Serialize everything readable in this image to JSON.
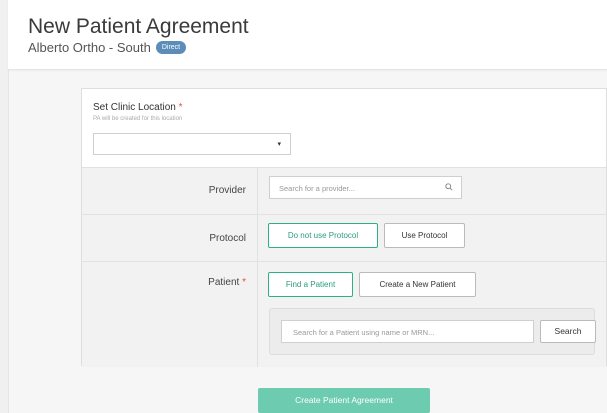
{
  "header": {
    "title": "New Patient Agreement",
    "subtitle": "Alberto Ortho - South",
    "badge": "Direct"
  },
  "location": {
    "label": "Set Clinic Location",
    "required_mark": "*",
    "help_text": "PA will be created for this location",
    "selected_value": "",
    "caret": "▾"
  },
  "provider": {
    "label": "Provider",
    "placeholder": "Search for a provider...",
    "search_icon": "search-icon"
  },
  "protocol": {
    "label": "Protocol",
    "options": [
      "Do not use Protocol",
      "Use Protocol"
    ],
    "selected": "Do not use Protocol"
  },
  "patient": {
    "label": "Patient",
    "required_mark": "*",
    "options": [
      "Find a Patient",
      "Create a New Patient"
    ],
    "selected": "Find a Patient",
    "search_placeholder": "Search for a Patient using name or MRN...",
    "search_button": "Search"
  },
  "footer": {
    "create_button": "Create Patient Agreement"
  },
  "colors": {
    "accent": "#2bb08c",
    "primary_button": "#6dcbb0",
    "badge": "#5b8db8",
    "required": "#d9534f"
  }
}
